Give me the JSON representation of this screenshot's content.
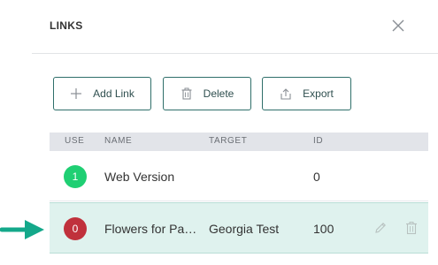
{
  "dialog": {
    "title": "LINKS"
  },
  "toolbar": {
    "add_label": "Add Link",
    "delete_label": "Delete",
    "export_label": "Export"
  },
  "table": {
    "columns": {
      "use": "USE",
      "name": "NAME",
      "target": "TARGET",
      "id": "ID"
    },
    "rows": [
      {
        "use": "1",
        "name": "Web Version",
        "target": "",
        "id": "0",
        "status_color": "#1fcf73"
      },
      {
        "use": "0",
        "name": "Flowers for Pa…",
        "target": "Georgia Test",
        "id": "100",
        "status_color": "#c0313c",
        "selected": true
      }
    ]
  },
  "icons": {
    "close": "close-icon",
    "add": "plus-icon",
    "delete": "trash-icon",
    "export": "export-icon",
    "row_edit": "pencil-icon",
    "row_delete": "trash-icon",
    "pointer": "arrow-right-icon"
  },
  "colors": {
    "accent": "#2f6f6a",
    "selected_row": "#dff2ee",
    "arrow": "#14a88a"
  }
}
